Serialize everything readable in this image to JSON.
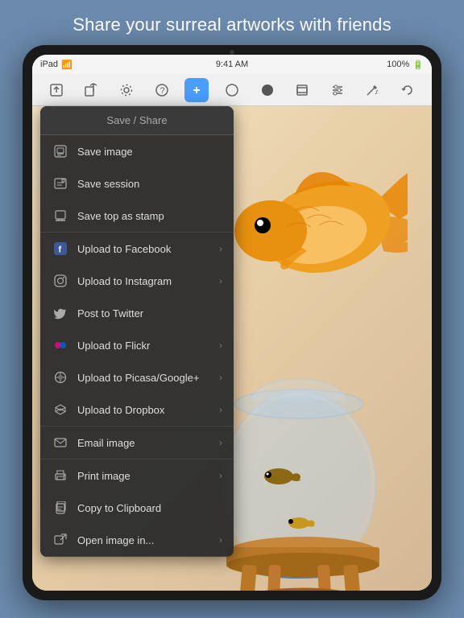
{
  "header": {
    "title": "Share your surreal artworks with friends"
  },
  "statusBar": {
    "left": "iPad",
    "time": "9:41 AM",
    "battery": "100%"
  },
  "toolbar": {
    "icons": [
      "export",
      "share",
      "settings",
      "help",
      "add",
      "circle",
      "record",
      "layers",
      "sliders",
      "wand",
      "undo"
    ]
  },
  "menu": {
    "title": "Save / Share",
    "sections": [
      {
        "items": [
          {
            "id": "save-image",
            "label": "Save image",
            "hasArrow": false
          },
          {
            "id": "save-session",
            "label": "Save session",
            "hasArrow": false
          },
          {
            "id": "save-stamp",
            "label": "Save top as stamp",
            "hasArrow": false
          }
        ]
      },
      {
        "items": [
          {
            "id": "facebook",
            "label": "Upload to Facebook",
            "hasArrow": true
          },
          {
            "id": "instagram",
            "label": "Upload to Instagram",
            "hasArrow": true
          },
          {
            "id": "twitter",
            "label": "Post to Twitter",
            "hasArrow": false
          },
          {
            "id": "flickr",
            "label": "Upload to Flickr",
            "hasArrow": true
          },
          {
            "id": "picasa",
            "label": "Upload to Picasa/Google+",
            "hasArrow": true
          },
          {
            "id": "dropbox",
            "label": "Upload to Dropbox",
            "hasArrow": true
          }
        ]
      },
      {
        "items": [
          {
            "id": "email",
            "label": "Email image",
            "hasArrow": true
          }
        ]
      },
      {
        "items": [
          {
            "id": "print",
            "label": "Print image",
            "hasArrow": true
          },
          {
            "id": "clipboard",
            "label": "Copy to Clipboard",
            "hasArrow": false
          },
          {
            "id": "open-in",
            "label": "Open image in...",
            "hasArrow": true
          }
        ]
      }
    ]
  },
  "icons": {
    "save_image": "⊞",
    "save_session": "✎",
    "save_stamp": "⊡",
    "facebook": "f",
    "instagram": "◎",
    "twitter": "𝕥",
    "flickr": "⊙",
    "picasa": "⊕",
    "dropbox": "❖",
    "email": "✉",
    "print": "⎙",
    "clipboard": "⧉",
    "open_in": "⊏",
    "arrow": "›"
  },
  "colors": {
    "accent": "#4a9eff",
    "menuBg": "rgba(45,45,45,0.97)",
    "textPrimary": "#dddddd",
    "textSecondary": "#aaaaaa"
  }
}
